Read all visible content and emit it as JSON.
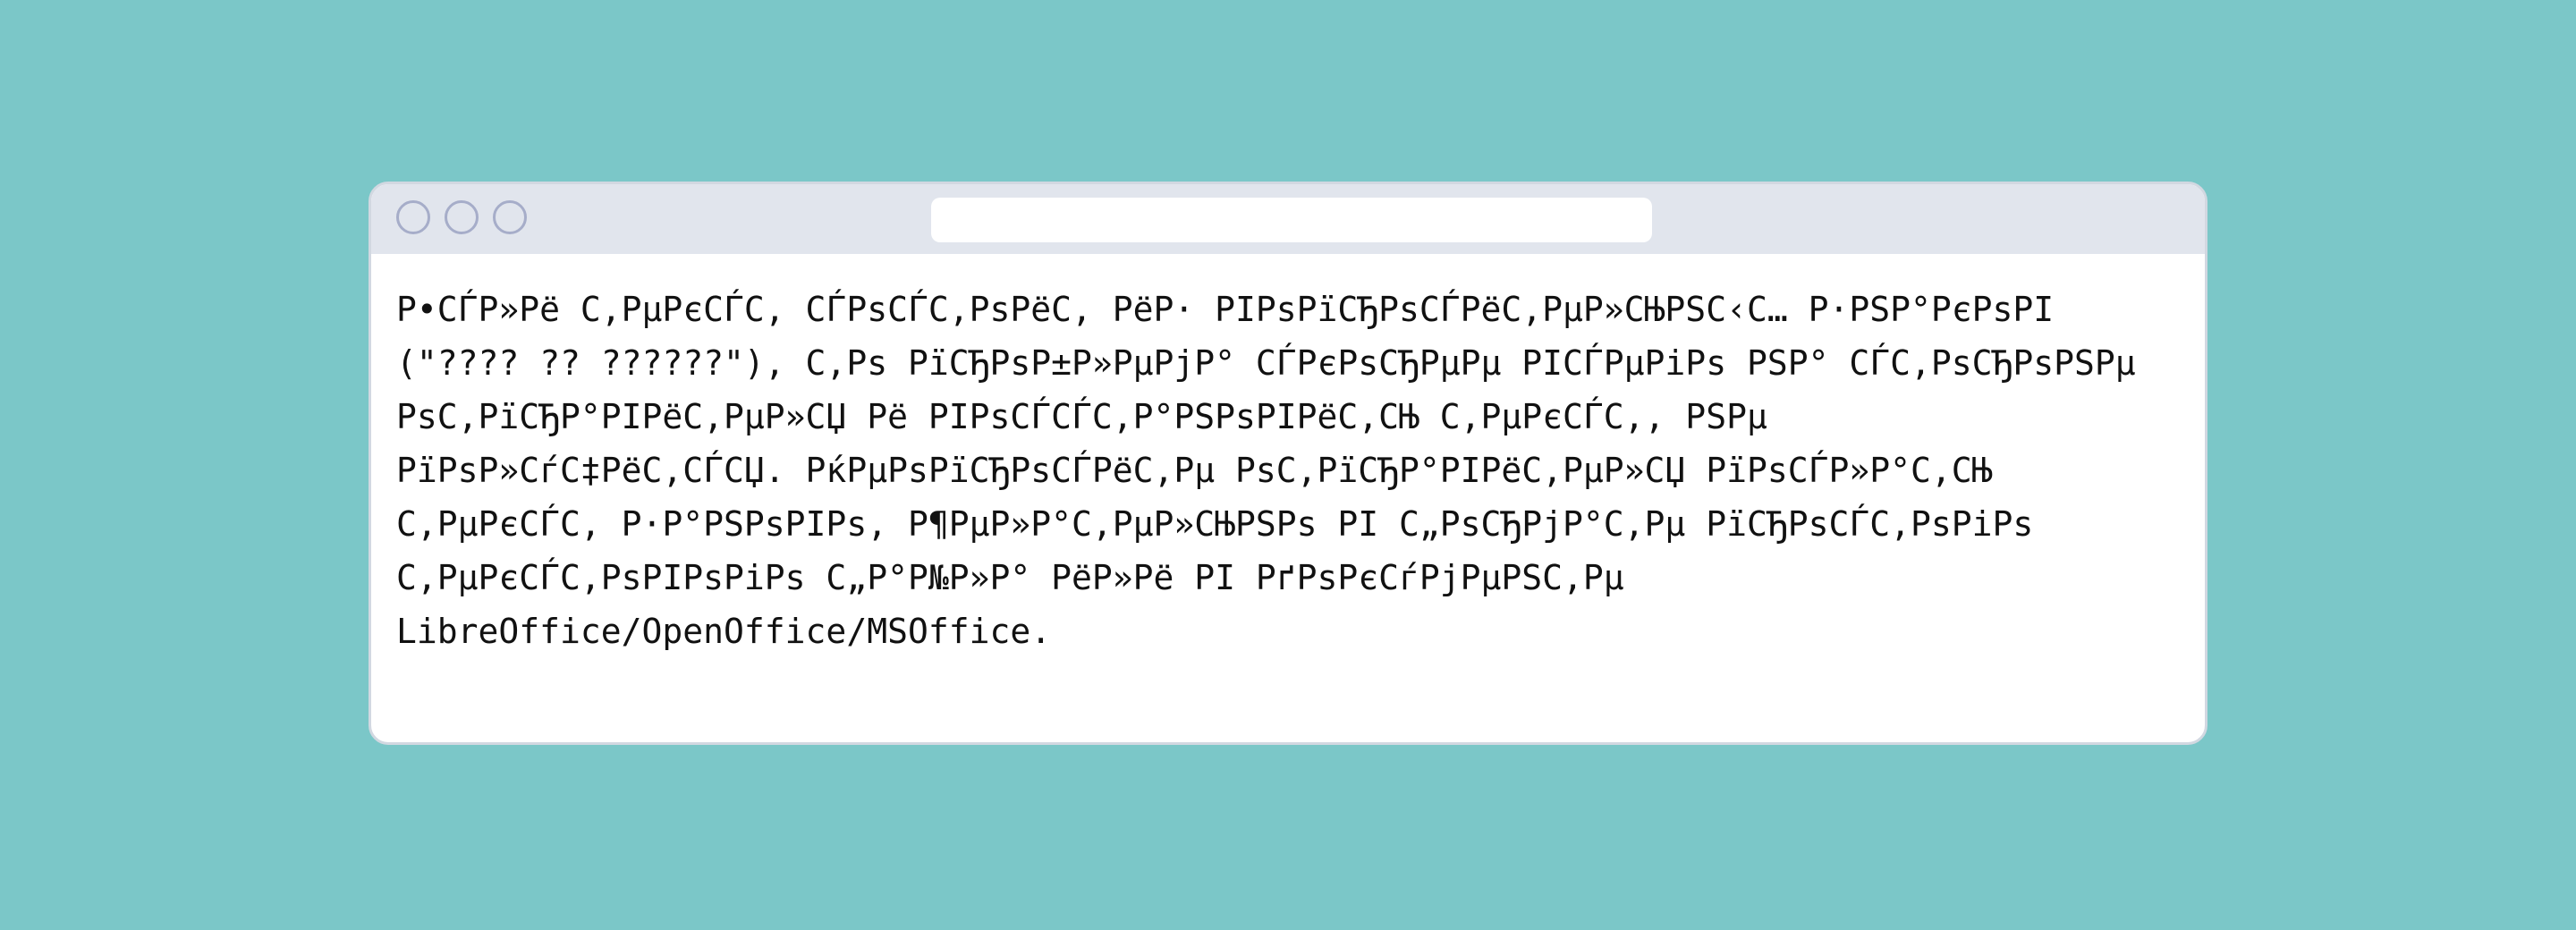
{
  "window": {
    "address_bar_text": "",
    "body_text": "Р•СЃР»Рё С‚РµРєСЃС‚ СЃРѕСЃС‚РѕРёС‚ РёР· РІРѕРїСЂРѕСЃРёС‚РµР»СЊРЅС‹С… Р·РЅР°РєРѕРІ (\"???? ?? ??????\"), С‚Рѕ РїСЂРѕР±Р»РµРјР° СЃРєРѕСЂРµРµ РІСЃРµРіРѕ РЅР° СЃС‚РѕСЂРѕРЅРµ РѕС‚РїСЂР°РІРёС‚РµР»СЏ Рё РІРѕСЃСЃС‚Р°РЅРѕРІРёС‚СЊ С‚РµРєСЃС‚, РЅРµ РїРѕР»СѓС‡РёС‚СЃСЏ. РќРµРѕРїСЂРѕСЃРёС‚Рµ РѕС‚РїСЂР°РІРёС‚РµР»СЏ РїРѕСЃР»Р°С‚СЊ С‚РµРєСЃС‚ Р·Р°РЅРѕРІРѕ, Р¶РµР»Р°С‚РµР»СЊРЅРѕ РІ С„РѕСЂРјР°С‚Рµ РїСЂРѕСЃС‚РѕРіРѕ С‚РµРєСЃС‚РѕРІРѕРіРѕ С„Р°Р№Р»Р° РёР»Рё РІ РґРѕРєСѓРјРµРЅС‚Рµ LibreOffice/OpenOffice/MSOffice."
  },
  "colors": {
    "background": "#7bc7c8",
    "window": "#ffffff",
    "titlebar": "#e1e5ed",
    "window_border": "#d2d8e1",
    "dot_outline": "#a6adc9",
    "text": "#111111"
  }
}
